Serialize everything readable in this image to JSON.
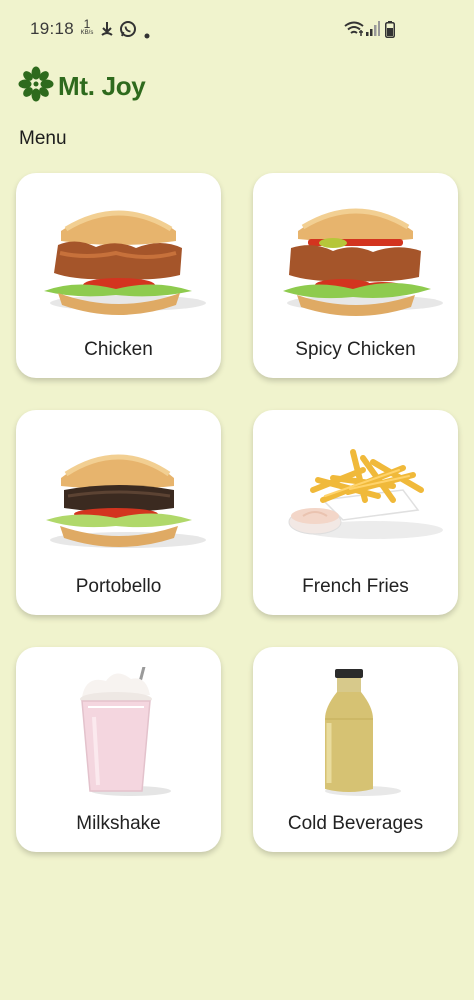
{
  "status_bar": {
    "time": "19:18",
    "net_speed_value": "1",
    "net_speed_unit": "KB/s"
  },
  "header": {
    "brand": "Mt. Joy"
  },
  "menu": {
    "title": "Menu",
    "items": [
      {
        "label": "Chicken"
      },
      {
        "label": "Spicy Chicken"
      },
      {
        "label": "Portobello"
      },
      {
        "label": "French Fries"
      },
      {
        "label": "Milkshake"
      },
      {
        "label": "Cold Beverages"
      }
    ]
  },
  "colors": {
    "background": "#f0f3cd",
    "brand_green": "#2e6a1d",
    "card": "#ffffff"
  },
  "icons": [
    "download-icon",
    "whatsapp-icon",
    "wifi-icon",
    "signal-icon",
    "battery-icon",
    "brand-logo-icon"
  ]
}
